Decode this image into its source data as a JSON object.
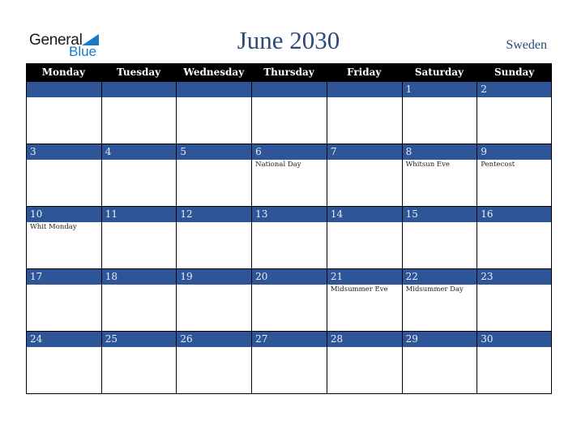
{
  "logo": {
    "word1": "General",
    "word2": "Blue"
  },
  "title": "June 2030",
  "country": "Sweden",
  "colors": {
    "header_bg": "#000000",
    "date_band": "#2e5597",
    "title": "#2b4a7a",
    "logo_blue": "#1a7bc4"
  },
  "weekdays": [
    "Monday",
    "Tuesday",
    "Wednesday",
    "Thursday",
    "Friday",
    "Saturday",
    "Sunday"
  ],
  "weeks": [
    [
      {
        "day": "",
        "event": ""
      },
      {
        "day": "",
        "event": ""
      },
      {
        "day": "",
        "event": ""
      },
      {
        "day": "",
        "event": ""
      },
      {
        "day": "",
        "event": ""
      },
      {
        "day": "1",
        "event": ""
      },
      {
        "day": "2",
        "event": ""
      }
    ],
    [
      {
        "day": "3",
        "event": ""
      },
      {
        "day": "4",
        "event": ""
      },
      {
        "day": "5",
        "event": ""
      },
      {
        "day": "6",
        "event": "National Day"
      },
      {
        "day": "7",
        "event": ""
      },
      {
        "day": "8",
        "event": "Whitsun Eve"
      },
      {
        "day": "9",
        "event": "Pentecost"
      }
    ],
    [
      {
        "day": "10",
        "event": "Whit Monday"
      },
      {
        "day": "11",
        "event": ""
      },
      {
        "day": "12",
        "event": ""
      },
      {
        "day": "13",
        "event": ""
      },
      {
        "day": "14",
        "event": ""
      },
      {
        "day": "15",
        "event": ""
      },
      {
        "day": "16",
        "event": ""
      }
    ],
    [
      {
        "day": "17",
        "event": ""
      },
      {
        "day": "18",
        "event": ""
      },
      {
        "day": "19",
        "event": ""
      },
      {
        "day": "20",
        "event": ""
      },
      {
        "day": "21",
        "event": "Midsummer Eve"
      },
      {
        "day": "22",
        "event": "Midsummer Day"
      },
      {
        "day": "23",
        "event": ""
      }
    ],
    [
      {
        "day": "24",
        "event": ""
      },
      {
        "day": "25",
        "event": ""
      },
      {
        "day": "26",
        "event": ""
      },
      {
        "day": "27",
        "event": ""
      },
      {
        "day": "28",
        "event": ""
      },
      {
        "day": "29",
        "event": ""
      },
      {
        "day": "30",
        "event": ""
      }
    ]
  ]
}
